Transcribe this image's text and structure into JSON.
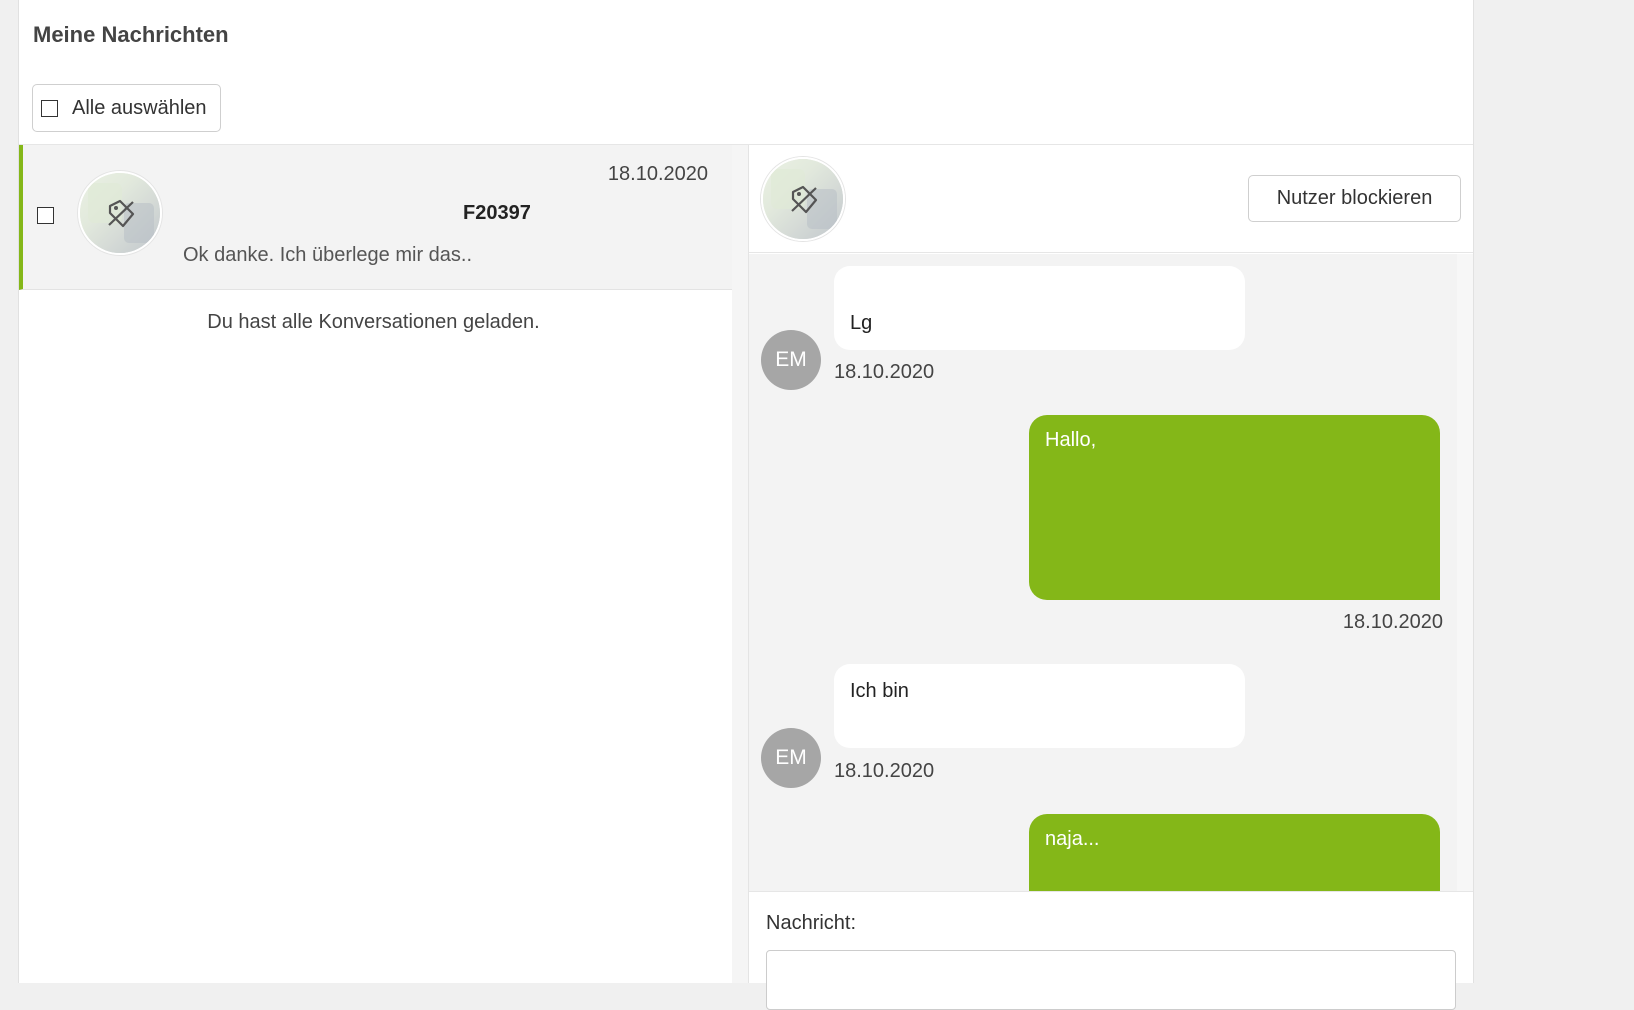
{
  "page": {
    "title": "Meine Nachrichten",
    "select_all_label": "Alle auswählen"
  },
  "colors": {
    "accent": "#84b718",
    "panel_bg": "#f3f3f3",
    "avatar_bg": "#a6a6a6"
  },
  "conversations": [
    {
      "date": "18.10.2020",
      "title": "F20397",
      "preview": "Ok danke. Ich überlege mir das..",
      "selected": true,
      "thumbnail_icon": "tag-off-icon"
    }
  ],
  "conversation_list_end": "Du hast alle Konversationen geladen.",
  "chat": {
    "block_button": "Nutzer blockieren",
    "messages": [
      {
        "direction": "incoming",
        "avatar": "EM",
        "text": "Lg",
        "date": "18.10.2020"
      },
      {
        "direction": "outgoing",
        "text": "Hallo,",
        "date": "18.10.2020"
      },
      {
        "direction": "incoming",
        "avatar": "EM",
        "text": "Ich bin",
        "date": "18.10.2020"
      },
      {
        "direction": "outgoing",
        "text": "naja..."
      }
    ],
    "composer_label": "Nachricht:",
    "composer_value": ""
  }
}
